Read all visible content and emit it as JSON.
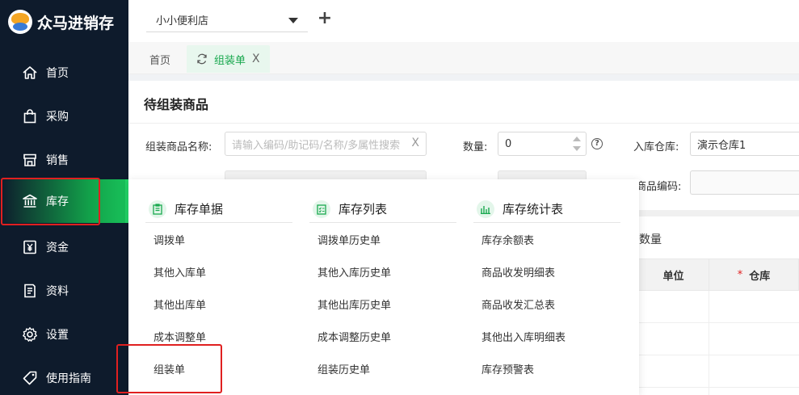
{
  "app": {
    "name": "众马进销存"
  },
  "sidebar": {
    "items": [
      {
        "label": "首页",
        "icon": "home-icon"
      },
      {
        "label": "采购",
        "icon": "bag-icon"
      },
      {
        "label": "销售",
        "icon": "store-icon"
      },
      {
        "label": "库存",
        "icon": "bank-icon"
      },
      {
        "label": "资金",
        "icon": "yen-icon"
      },
      {
        "label": "资料",
        "icon": "document-icon"
      },
      {
        "label": "设置",
        "icon": "gear-icon"
      },
      {
        "label": "使用指南",
        "icon": "tag-icon"
      }
    ],
    "active_index": 3,
    "accent_color": "#19c25a"
  },
  "topbar": {
    "store": "小小便利店",
    "add_label": "+"
  },
  "tabs": {
    "home": "首页",
    "active": "组装单",
    "close": "X"
  },
  "form": {
    "title": "待组装商品",
    "name_label": "组装商品名称:",
    "name_placeholder": "请输入编码/助记码/名称/多属性搜索",
    "clear": "X",
    "qty_label": "数量:",
    "qty_value": "0",
    "help": "?",
    "warehouse_label": "入库仓库:",
    "warehouse_value": "演示仓库1",
    "code_label": "商品编码:",
    "qty_partial": "数量"
  },
  "table": {
    "headers": [
      "单位",
      "仓库"
    ],
    "required_mark": "*"
  },
  "dropdown": {
    "columns": [
      {
        "title": "库存单据",
        "icon": "clipboard-icon",
        "items": [
          "调拨单",
          "其他入库单",
          "其他出库单",
          "成本调整单",
          "组装单"
        ]
      },
      {
        "title": "库存列表",
        "icon": "checklist-icon",
        "items": [
          "调拨单历史单",
          "其他入库历史单",
          "其他出库历史单",
          "成本调整历史单",
          "组装历史单"
        ]
      },
      {
        "title": "库存统计表",
        "icon": "bar-chart-icon",
        "items": [
          "库存余额表",
          "商品收发明细表",
          "商品收发汇总表",
          "其他出入库明细表",
          "库存预警表"
        ]
      }
    ]
  }
}
